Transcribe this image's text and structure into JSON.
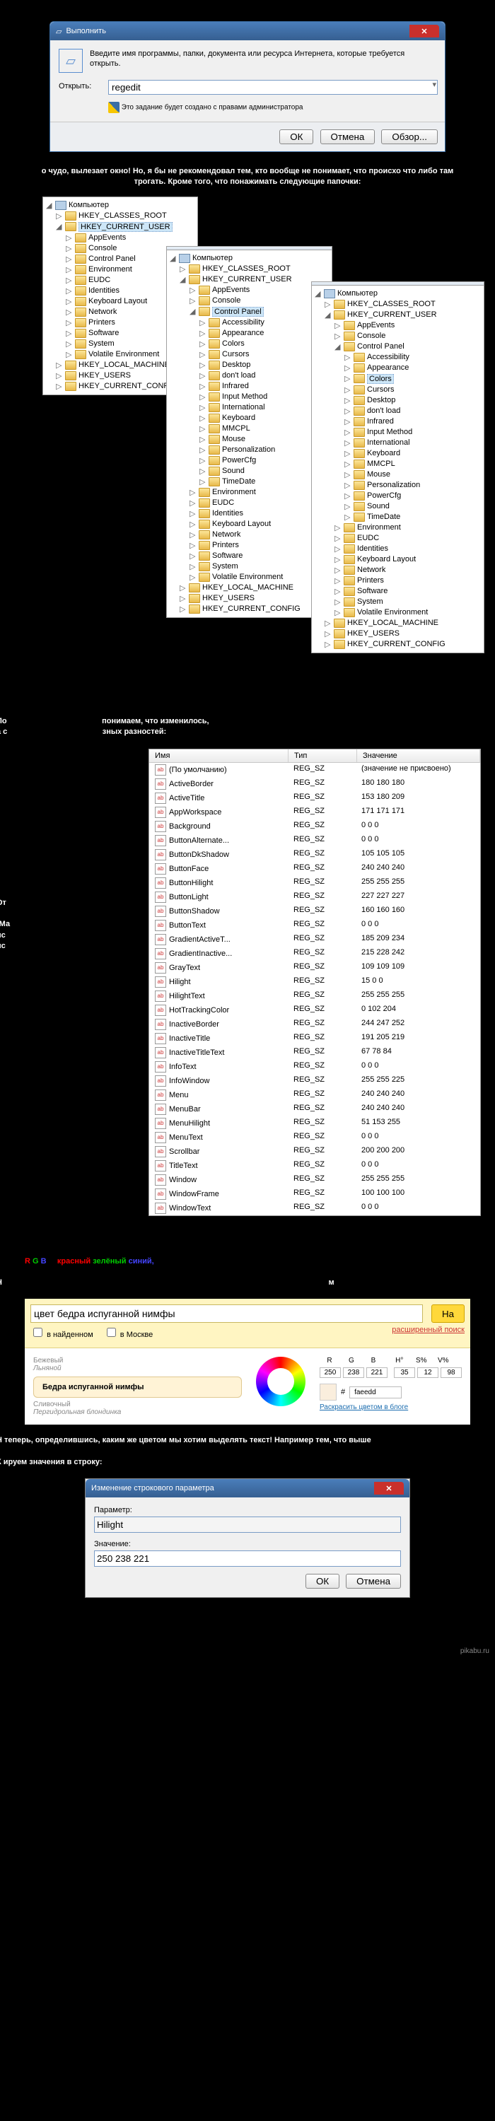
{
  "run_dialog": {
    "title": "Выполнить",
    "description": "Введите имя программы, папки, документа или ресурса Интернета, которые требуется открыть.",
    "open_label": "Открыть:",
    "input_value": "regedit",
    "admin_note": "Это задание будет создано с правами администратора",
    "btn_ok": "ОК",
    "btn_cancel": "Отмена",
    "btn_browse": "Обзор..."
  },
  "text1": "о чудо, вылезает окно! Но, я бы не рекомендовал тем, кто вообще не понимает, что происхо что либо там трогать. Кроме того, что понажимать следующие папочки:",
  "text2_a": "По",
  "text2_b": "понимаем, что изменилось,",
  "text2_c": "а с",
  "text2_d": "зных разностей:",
  "text3": "От",
  "text4": "(Ма",
  "rgb_line_prefix": "",
  "rgb_rgb": "R G B",
  "rgb_words": {
    "r": "красный",
    "g": "зелёный",
    "b": "синий,"
  },
  "text5": "Н",
  "text5b": "м",
  "yandex": {
    "query": "цвет бедра испуганной нимфы",
    "btn": "На",
    "flt_found": "в найденном",
    "flt_moscow": "в Москве",
    "adv": "расширенный поиск",
    "c1": "Бежевый",
    "c2": "Льняной",
    "c_main": "Бедра испуганной нимфы",
    "c3": "Сливочный",
    "c4": "Пергидрольная блондинка",
    "R": "R",
    "G": "G",
    "B": "B",
    "H": "H°",
    "S": "S%",
    "V": "V%",
    "rv": "250",
    "gv": "238",
    "bv": "221",
    "hv": "35",
    "sv": "12",
    "vv": "98",
    "hex": "faeedd",
    "blog": "Раскрасить цветом в блоге"
  },
  "text6": "Н    теперь, определившись, каким же цветом мы хотим выделять текст! Например тем, что выше",
  "text7": "К    ируем значения в строку:",
  "editstr": {
    "title": "Изменение строкового параметра",
    "lbl_param": "Параметр:",
    "param_value": "Hilight",
    "lbl_value": "Значение:",
    "value": "250 238 221",
    "btn_ok": "ОК",
    "btn_cancel": "Отмена"
  },
  "tree": {
    "computer": "Компьютер",
    "hkcr": "HKEY_CLASSES_ROOT",
    "hkcu": "HKEY_CURRENT_USER",
    "appevents": "AppEvents",
    "console": "Console",
    "cp": "Control Panel",
    "env": "Environment",
    "eudc": "EUDC",
    "ident": "Identities",
    "kbd": "Keyboard Layout",
    "net": "Network",
    "prn": "Printers",
    "sw": "Software",
    "sys": "System",
    "vol": "Volatile Environment",
    "hklm": "HKEY_LOCAL_MACHINE",
    "hku": "HKEY_USERS",
    "hkcc": "HKEY_CURRENT_CONFIG",
    "acc": "Accessibility",
    "appear": "Appearance",
    "colors": "Colors",
    "cursors": "Cursors",
    "desktop": "Desktop",
    "dontload": "don't load",
    "infrared": "Infrared",
    "input": "Input Method",
    "intl": "International",
    "kbd2": "Keyboard",
    "mmcpl": "MMCPL",
    "mouse": "Mouse",
    "pers": "Personalization",
    "power": "PowerCfg",
    "sound": "Sound",
    "time": "TimeDate"
  },
  "reg": {
    "h_name": "Имя",
    "h_type": "Тип",
    "h_val": "Значение",
    "default_name": "(По умолчанию)",
    "default_val": "(значение не присвоено)",
    "rows": [
      [
        "ActiveBorder",
        "REG_SZ",
        "180 180 180"
      ],
      [
        "ActiveTitle",
        "REG_SZ",
        "153 180 209"
      ],
      [
        "AppWorkspace",
        "REG_SZ",
        "171 171 171"
      ],
      [
        "Background",
        "REG_SZ",
        "0 0 0"
      ],
      [
        "ButtonAlternate...",
        "REG_SZ",
        "0 0 0"
      ],
      [
        "ButtonDkShadow",
        "REG_SZ",
        "105 105 105"
      ],
      [
        "ButtonFace",
        "REG_SZ",
        "240 240 240"
      ],
      [
        "ButtonHilight",
        "REG_SZ",
        "255 255 255"
      ],
      [
        "ButtonLight",
        "REG_SZ",
        "227 227 227"
      ],
      [
        "ButtonShadow",
        "REG_SZ",
        "160 160 160"
      ],
      [
        "ButtonText",
        "REG_SZ",
        "0 0 0"
      ],
      [
        "GradientActiveT...",
        "REG_SZ",
        "185 209 234"
      ],
      [
        "GradientInactive...",
        "REG_SZ",
        "215 228 242"
      ],
      [
        "GrayText",
        "REG_SZ",
        "109 109 109"
      ],
      [
        "Hilight",
        "REG_SZ",
        "15 0 0"
      ],
      [
        "HilightText",
        "REG_SZ",
        "255 255 255"
      ],
      [
        "HotTrackingColor",
        "REG_SZ",
        "0 102 204"
      ],
      [
        "InactiveBorder",
        "REG_SZ",
        "244 247 252"
      ],
      [
        "InactiveTitle",
        "REG_SZ",
        "191 205 219"
      ],
      [
        "InactiveTitleText",
        "REG_SZ",
        "67 78 84"
      ],
      [
        "InfoText",
        "REG_SZ",
        "0 0 0"
      ],
      [
        "InfoWindow",
        "REG_SZ",
        "255 255 225"
      ],
      [
        "Menu",
        "REG_SZ",
        "240 240 240"
      ],
      [
        "MenuBar",
        "REG_SZ",
        "240 240 240"
      ],
      [
        "MenuHilight",
        "REG_SZ",
        "51 153 255"
      ],
      [
        "MenuText",
        "REG_SZ",
        "0 0 0"
      ],
      [
        "Scrollbar",
        "REG_SZ",
        "200 200 200"
      ],
      [
        "TitleText",
        "REG_SZ",
        "0 0 0"
      ],
      [
        "Window",
        "REG_SZ",
        "255 255 255"
      ],
      [
        "WindowFrame",
        "REG_SZ",
        "100 100 100"
      ],
      [
        "WindowText",
        "REG_SZ",
        "0 0 0"
      ]
    ]
  },
  "watermark": "pikabu.ru"
}
